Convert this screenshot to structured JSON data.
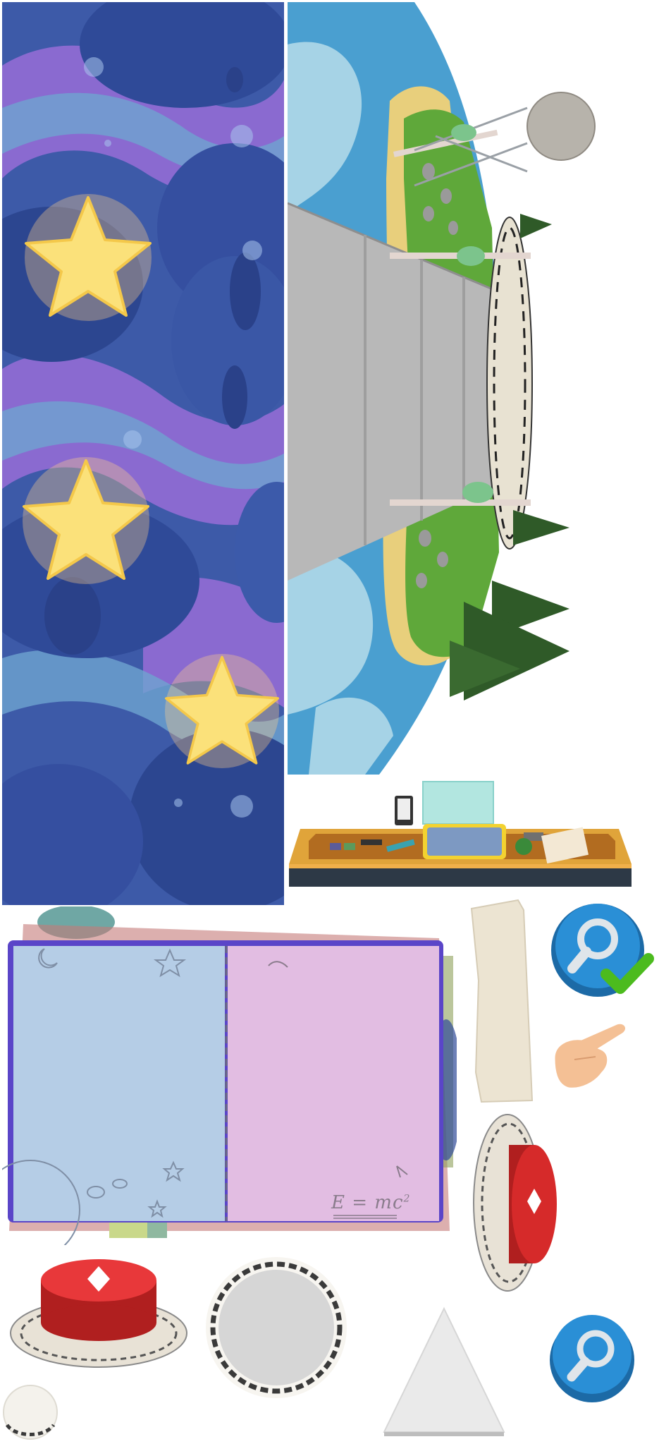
{
  "sprite_sheet": {
    "kind": "game texture atlas",
    "sprites": [
      {
        "id": "night-cloud-background",
        "stars": 3
      },
      {
        "id": "island-launch-scene"
      },
      {
        "id": "control-desk"
      },
      {
        "id": "open-notebook",
        "formula": {
          "base": "E = mc",
          "exponent": "2"
        }
      },
      {
        "id": "paper-strip"
      },
      {
        "id": "search-button-checked"
      },
      {
        "id": "pointing-hand"
      },
      {
        "id": "launch-button-side"
      },
      {
        "id": "launch-button-front"
      },
      {
        "id": "launch-pad-disc"
      },
      {
        "id": "paper-triangle"
      },
      {
        "id": "search-button"
      },
      {
        "id": "pad-fragment"
      }
    ]
  },
  "colors": {
    "night_sky": "#3d5aa8",
    "cloud_purple": "#8a6ad0",
    "star_yellow": "#fbe17a",
    "water_blue": "#4a9fd0",
    "grass_green": "#5fa83a",
    "sand": "#e8cf7c",
    "road_grey": "#b8b8b8",
    "desk_orange": "#e0a43a",
    "notebook_purple": "#5a45c8",
    "page_blue": "#b5cde6",
    "page_pink": "#e2bde2",
    "button_red": "#d62a2a",
    "search_blue": "#2a8fd6",
    "check_green": "#4cbb1e"
  }
}
